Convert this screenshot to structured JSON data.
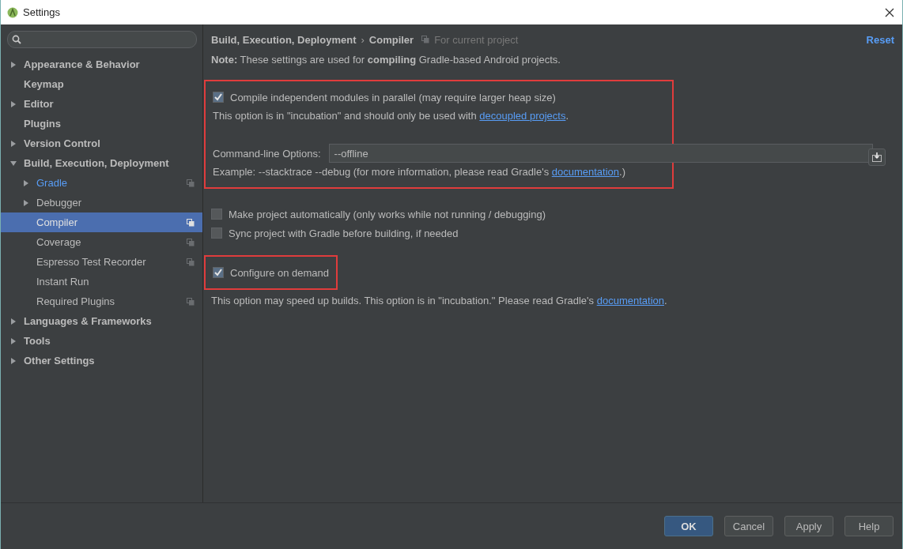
{
  "window": {
    "title": "Settings"
  },
  "sidebar": {
    "items": [
      {
        "kind": "group",
        "label": "Appearance & Behavior",
        "expanded": false,
        "selected": false,
        "modified": false,
        "project_scope": false
      },
      {
        "kind": "leaf",
        "label": "Keymap",
        "selected": false,
        "modified": false,
        "project_scope": false
      },
      {
        "kind": "group",
        "label": "Editor",
        "expanded": false,
        "selected": false,
        "modified": false,
        "project_scope": false
      },
      {
        "kind": "leaf",
        "label": "Plugins",
        "selected": false,
        "modified": false,
        "project_scope": false
      },
      {
        "kind": "group",
        "label": "Version Control",
        "expanded": false,
        "selected": false,
        "modified": false,
        "project_scope": false
      },
      {
        "kind": "group",
        "label": "Build, Execution, Deployment",
        "expanded": true,
        "selected": false,
        "modified": false,
        "project_scope": false,
        "children": [
          {
            "kind": "group",
            "label": "Gradle",
            "expanded": false,
            "selected": false,
            "modified": true,
            "project_scope": true
          },
          {
            "kind": "group",
            "label": "Debugger",
            "expanded": false,
            "selected": false,
            "modified": false,
            "project_scope": false
          },
          {
            "kind": "leaf",
            "label": "Compiler",
            "selected": true,
            "modified": false,
            "project_scope": true
          },
          {
            "kind": "leaf",
            "label": "Coverage",
            "selected": false,
            "modified": false,
            "project_scope": true
          },
          {
            "kind": "leaf",
            "label": "Espresso Test Recorder",
            "selected": false,
            "modified": false,
            "project_scope": true
          },
          {
            "kind": "leaf",
            "label": "Instant Run",
            "selected": false,
            "modified": false,
            "project_scope": false
          },
          {
            "kind": "leaf",
            "label": "Required Plugins",
            "selected": false,
            "modified": false,
            "project_scope": true
          }
        ]
      },
      {
        "kind": "group",
        "label": "Languages & Frameworks",
        "expanded": false,
        "selected": false,
        "modified": false,
        "project_scope": false
      },
      {
        "kind": "group",
        "label": "Tools",
        "expanded": false,
        "selected": false,
        "modified": false,
        "project_scope": false
      },
      {
        "kind": "group",
        "label": "Other Settings",
        "expanded": false,
        "selected": false,
        "modified": false,
        "project_scope": false
      }
    ]
  },
  "breadcrumb": {
    "path": [
      "Build, Execution, Deployment",
      "Compiler"
    ],
    "separator": "›",
    "scope": "For current project"
  },
  "reset": "Reset",
  "note": "**Note:** These settings are used for **compiling** Gradle-based Android projects.",
  "groups": [
    {
      "highlighted": true,
      "items": [
        {
          "kind": "checkbox",
          "label": "Compile independent modules in parallel (may require larger heap size)",
          "checked": true
        },
        {
          "kind": "text",
          "text": "This option is in \"incubation\" and should only be used with ",
          "link": "decoupled projects",
          "after": "."
        },
        {
          "kind": "field",
          "label": "Command-line Options:",
          "value": "--offline"
        },
        {
          "kind": "text",
          "text": "Example: --stacktrace --debug (for more information, please read Gradle's ",
          "link": "documentation",
          "after": ".)"
        }
      ]
    },
    {
      "highlighted": false,
      "items": [
        {
          "kind": "checkbox",
          "label": "Make project automatically (only works while not running / debugging)",
          "checked": false
        },
        {
          "kind": "checkbox",
          "label": "Sync project with Gradle before building, if needed",
          "checked": false
        }
      ]
    },
    {
      "highlighted": true,
      "items": [
        {
          "kind": "checkbox",
          "label": "Configure on demand",
          "checked": true
        }
      ]
    },
    {
      "highlighted": false,
      "items": [
        {
          "kind": "text",
          "text": "This option may speed up builds. This option is in \"incubation.\" Please read Gradle's ",
          "link": "documentation",
          "after": "."
        }
      ]
    }
  ],
  "buttons": [
    {
      "label": "OK",
      "default": true
    },
    {
      "label": "Cancel",
      "default": false
    },
    {
      "label": "Apply",
      "default": false
    },
    {
      "label": "Help",
      "default": false
    }
  ]
}
